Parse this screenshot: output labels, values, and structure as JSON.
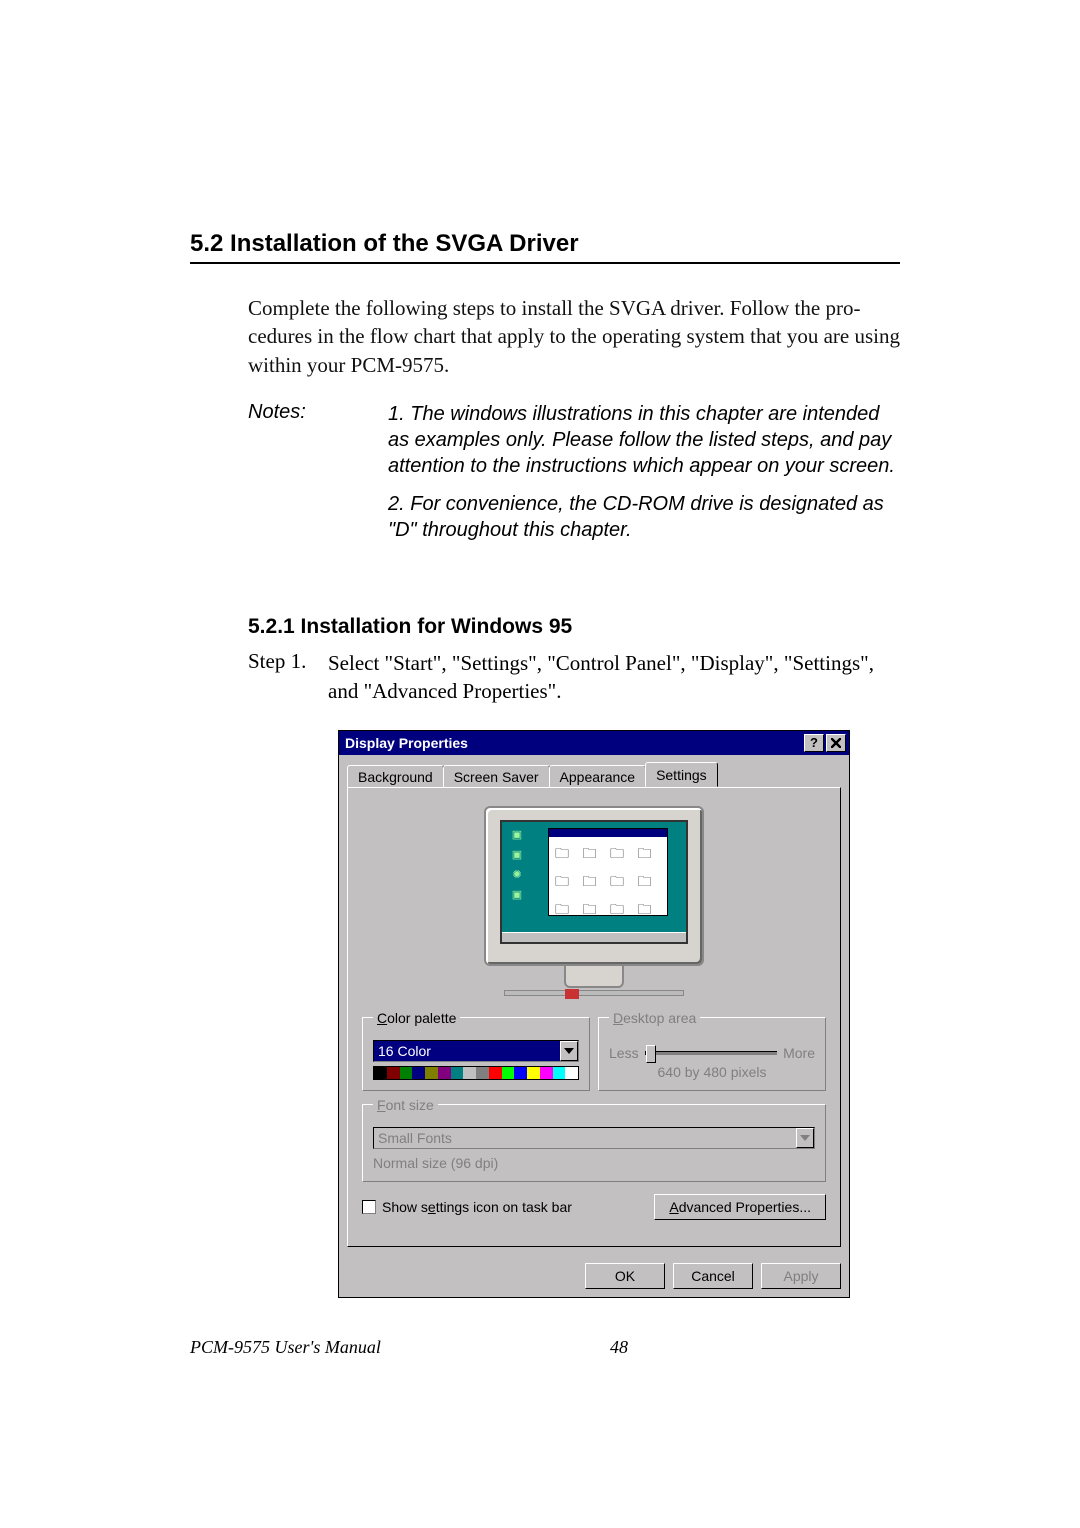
{
  "section": {
    "title": "5.2  Installation of the SVGA Driver",
    "intro": "Complete the following steps to install the SVGA driver. Follow the pro­cedures in the flow chart that apply to the operating system that you are using within your PCM-9575.",
    "notesLabel": "Notes:",
    "note1": "1.  The windows illustrations in this chapter are intended as examples only. Please follow the listed steps, and pay attention to the instruc­tions which appear on your screen.",
    "note2": "2.  For convenience, the CD-ROM drive is des­ignated as \"D\" throughout this chapter."
  },
  "subsection": {
    "title": "5.2.1  Installation for Windows 95",
    "stepLabel": "Step 1.",
    "stepText": "Select \"Start\", \"Settings\", \"Control Panel\", \"Display\", \"Settings\", and \"Advanced Properties\"."
  },
  "dialog": {
    "title": "Display Properties",
    "helpBtn": "?",
    "tabs": {
      "background": "Background",
      "screensaver": "Screen Saver",
      "appearance": "Appearance",
      "settings": "Settings"
    },
    "colorPalette": {
      "legend": "Color palette",
      "value": "16 Color",
      "swatches": [
        "#000000",
        "#800000",
        "#008000",
        "#000080",
        "#808000",
        "#800080",
        "#008080",
        "#c0c0c0",
        "#808080",
        "#ff0000",
        "#00ff00",
        "#0000ff",
        "#ffff00",
        "#ff00ff",
        "#00ffff",
        "#ffffff"
      ]
    },
    "desktopArea": {
      "legend": "Desktop area",
      "less": "Less",
      "more": "More",
      "resolution": "640 by 480 pixels"
    },
    "fontSize": {
      "legend": "Font size",
      "value": "Small Fonts",
      "detail": "Normal size (96 dpi)"
    },
    "checkbox": "Show settings icon on task bar",
    "advanced": "Advanced Properties...",
    "ok": "OK",
    "cancel": "Cancel",
    "apply": "Apply"
  },
  "footer": {
    "manual": "PCM-9575 User's Manual",
    "page": "48"
  }
}
